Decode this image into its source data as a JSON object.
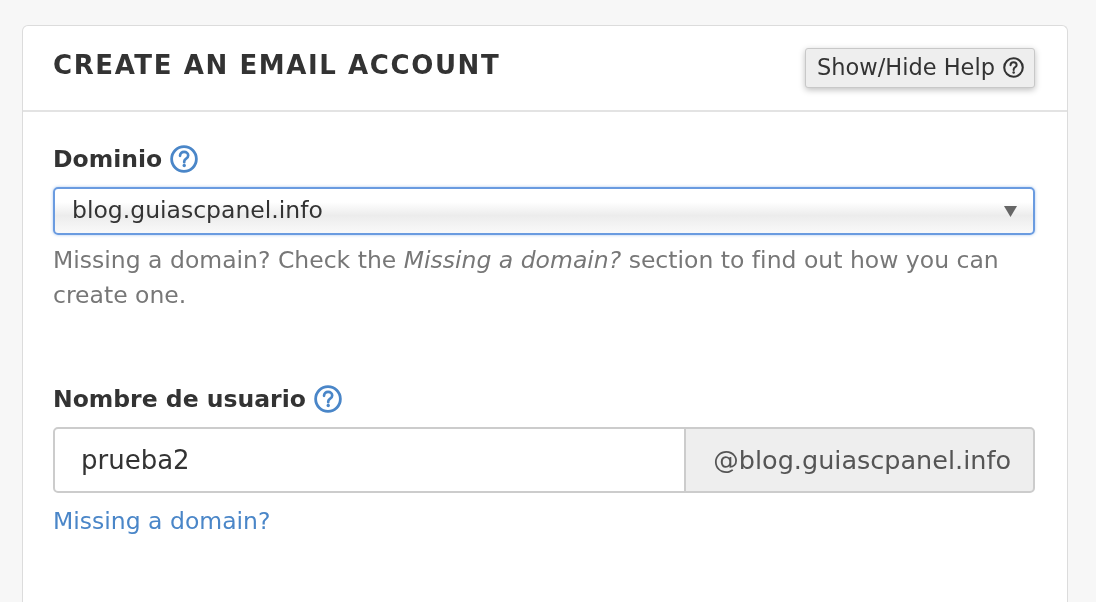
{
  "panel": {
    "title": "CREATE AN EMAIL ACCOUNT",
    "help_button": {
      "label": "Show/Hide Help"
    }
  },
  "fields": [
    {
      "kind": "select",
      "label": "Dominio",
      "value": "blog.guiascpanel.info",
      "focused": true,
      "help_text": "Missing a domain? Check the *Missing a domain?* section to find out how you can create one."
    },
    {
      "kind": "input_group",
      "label": "Nombre de usuario",
      "value": "prueba2",
      "focused": false,
      "addon": "@blog.guiascpanel.info",
      "link": "Missing a domain?"
    }
  ]
}
